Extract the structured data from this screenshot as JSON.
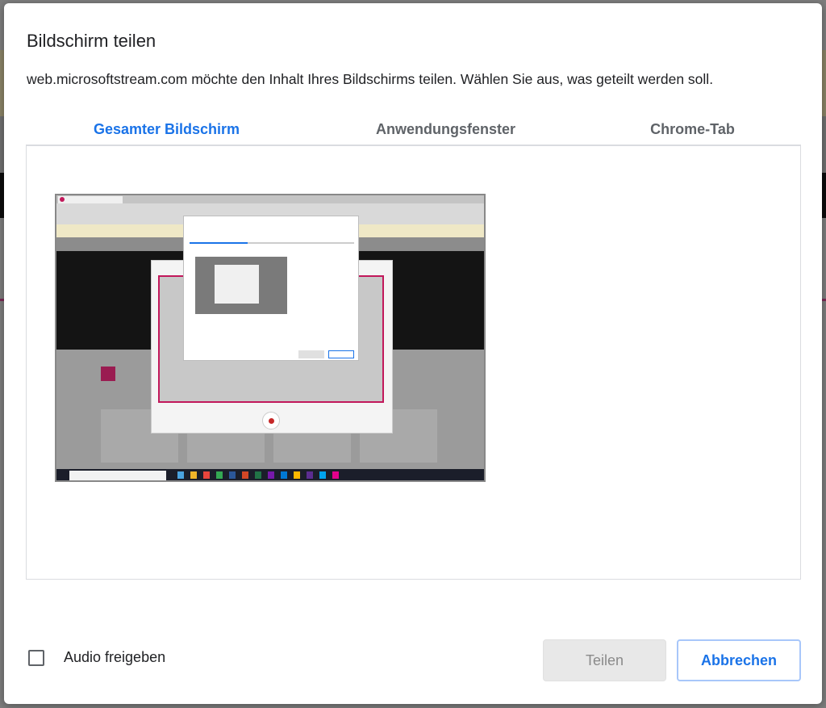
{
  "dialog": {
    "title": "Bildschirm teilen",
    "subtitle": "web.microsoftstream.com möchte den Inhalt Ihres Bildschirms teilen. Wählen Sie aus, was geteilt werden soll."
  },
  "tabs": [
    {
      "label": "Gesamter Bildschirm",
      "active": true
    },
    {
      "label": "Anwendungsfenster",
      "active": false
    },
    {
      "label": "Chrome-Tab",
      "active": false
    }
  ],
  "audio": {
    "label": "Audio freigeben",
    "checked": false
  },
  "buttons": {
    "share_label": "Teilen",
    "cancel_label": "Abbrechen"
  },
  "colors": {
    "accent": "#1a73e8",
    "tab_inactive": "#5f6368",
    "disabled_button_bg": "#e8e8e8"
  }
}
